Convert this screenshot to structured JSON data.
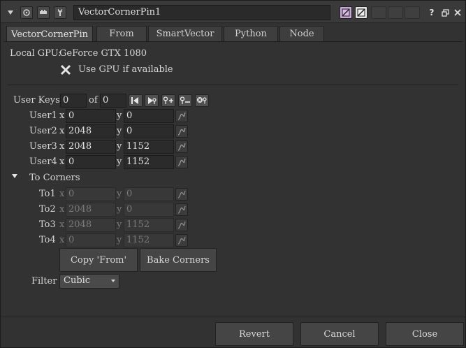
{
  "title": {
    "node_name": "VectorCornerPin1",
    "help": "?"
  },
  "tabs": [
    "VectorCornerPin",
    "From",
    "SmartVector",
    "Python",
    "Node"
  ],
  "gpu": {
    "label": "Local GPU:",
    "value": "GeForce GTX 1080",
    "use_gpu_label": "Use GPU if available"
  },
  "user_keys": {
    "label": "User Keys",
    "current": "0",
    "of_label": "of",
    "total": "0"
  },
  "x_label": "x",
  "y_label": "y",
  "users": [
    {
      "label": "User1",
      "x": "0",
      "y": "0"
    },
    {
      "label": "User2",
      "x": "2048",
      "y": "0"
    },
    {
      "label": "User3",
      "x": "2048",
      "y": "1152"
    },
    {
      "label": "User4",
      "x": "0",
      "y": "1152"
    }
  ],
  "to_corners": {
    "label": "To Corners",
    "items": [
      {
        "label": "To1",
        "x": "0",
        "y": "0"
      },
      {
        "label": "To2",
        "x": "2048",
        "y": "0"
      },
      {
        "label": "To3",
        "x": "2048",
        "y": "1152"
      },
      {
        "label": "To4",
        "x": "0",
        "y": "1152"
      }
    ]
  },
  "buttons": {
    "copy_from": "Copy 'From'",
    "bake_corners": "Bake Corners"
  },
  "filter": {
    "label": "Filter",
    "value": "Cubic"
  },
  "footer": {
    "revert": "Revert",
    "cancel": "Cancel",
    "close": "Close"
  }
}
